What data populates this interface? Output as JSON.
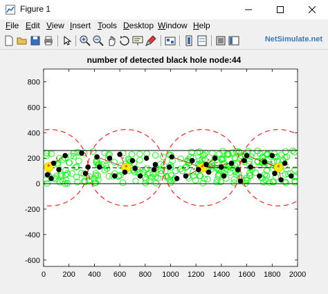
{
  "window": {
    "title": "Figure 1",
    "minimize_icon": "minimize-icon",
    "maximize_icon": "maximize-icon",
    "close_icon": "close-icon"
  },
  "menu": [
    {
      "label": "File",
      "key": "F"
    },
    {
      "label": "Edit",
      "key": "E"
    },
    {
      "label": "View",
      "key": "V"
    },
    {
      "label": "Insert",
      "key": "I"
    },
    {
      "label": "Tools",
      "key": "T"
    },
    {
      "label": "Desktop",
      "key": "D"
    },
    {
      "label": "Window",
      "key": "W"
    },
    {
      "label": "Help",
      "key": "H"
    }
  ],
  "toolbar": {
    "icons": [
      "new-figure-icon",
      "open-file-icon",
      "save-icon",
      "print-icon",
      "edit-plot-arrow-icon",
      "zoom-in-icon",
      "zoom-out-icon",
      "pan-icon",
      "rotate-3d-icon",
      "data-cursor-icon",
      "brush-icon",
      "link-plot-icon",
      "insert-colorbar-icon",
      "insert-legend-icon",
      "hide-plot-tools-icon",
      "show-plot-tools-icon"
    ]
  },
  "watermark": "NetSimulate.net",
  "chart_data": {
    "type": "scatter",
    "title": "number of detected black hole node:44",
    "xlabel": "",
    "ylabel": "",
    "xlim": [
      0,
      2000
    ],
    "ylim": [
      -650,
      900
    ],
    "xticks": [
      "0",
      "200",
      "400",
      "600",
      "800",
      "1000",
      "1200",
      "1400",
      "1600",
      "1800",
      "2000"
    ],
    "yticks": [
      "800",
      "600",
      "400",
      "200",
      "0",
      "-200",
      "-400",
      "-600"
    ],
    "xtick_values": [
      0,
      200,
      400,
      600,
      800,
      1000,
      1200,
      1400,
      1600,
      1800,
      2000
    ],
    "ytick_values": [
      800,
      600,
      400,
      200,
      0,
      -200,
      -400,
      -600
    ],
    "grid": false,
    "colors": {
      "normal_node": "#00ff00",
      "black_hole_node": "#000000",
      "cluster_head": "#ffee00",
      "range_circle": "#ff2020",
      "link": "#cc0000",
      "boundary": "#000000"
    },
    "range_circles": [
      {
        "cx": 50,
        "cy": 125,
        "r": 300
      },
      {
        "cx": 650,
        "cy": 125,
        "r": 300
      },
      {
        "cx": 1250,
        "cy": 125,
        "r": 300
      },
      {
        "cx": 1850,
        "cy": 125,
        "r": 300
      }
    ],
    "boundary_lines": [
      {
        "y": 260,
        "style": "solid"
      },
      {
        "y": 125,
        "style": "dashed"
      },
      {
        "y": 0,
        "style": "solid"
      }
    ],
    "cluster_heads": [
      {
        "x": 40,
        "y": 130
      },
      {
        "x": 650,
        "y": 125
      },
      {
        "x": 1250,
        "y": 125
      },
      {
        "x": 1850,
        "y": 125
      }
    ],
    "black_hole_nodes": [
      {
        "x": 30,
        "y": 70
      },
      {
        "x": 80,
        "y": 160
      },
      {
        "x": 60,
        "y": 40
      },
      {
        "x": 170,
        "y": 220
      },
      {
        "x": 300,
        "y": 240
      },
      {
        "x": 330,
        "y": 80
      },
      {
        "x": 420,
        "y": 210
      },
      {
        "x": 350,
        "y": 130
      },
      {
        "x": 440,
        "y": 130
      },
      {
        "x": 520,
        "y": 200
      },
      {
        "x": 560,
        "y": 60
      },
      {
        "x": 600,
        "y": 230
      },
      {
        "x": 700,
        "y": 180
      },
      {
        "x": 720,
        "y": 120
      },
      {
        "x": 640,
        "y": 90
      },
      {
        "x": 810,
        "y": 200
      },
      {
        "x": 870,
        "y": 110
      },
      {
        "x": 880,
        "y": 150
      },
      {
        "x": 990,
        "y": 130
      },
      {
        "x": 1050,
        "y": 40
      },
      {
        "x": 1010,
        "y": 210
      },
      {
        "x": 1170,
        "y": 180
      },
      {
        "x": 1120,
        "y": 60
      },
      {
        "x": 1220,
        "y": 110
      },
      {
        "x": 1280,
        "y": 150
      },
      {
        "x": 1300,
        "y": 90
      },
      {
        "x": 1350,
        "y": 200
      },
      {
        "x": 1400,
        "y": 130
      },
      {
        "x": 1420,
        "y": 60
      },
      {
        "x": 1480,
        "y": 160
      },
      {
        "x": 1530,
        "y": 110
      },
      {
        "x": 1600,
        "y": 220
      },
      {
        "x": 1630,
        "y": 130
      },
      {
        "x": 1700,
        "y": 60
      },
      {
        "x": 1740,
        "y": 170
      },
      {
        "x": 1800,
        "y": 220
      },
      {
        "x": 1820,
        "y": 80
      },
      {
        "x": 1870,
        "y": 30
      },
      {
        "x": 1900,
        "y": 160
      },
      {
        "x": 1950,
        "y": 60
      },
      {
        "x": 1550,
        "y": 20
      },
      {
        "x": 1580,
        "y": 180
      },
      {
        "x": 760,
        "y": 60
      },
      {
        "x": 120,
        "y": 110
      }
    ],
    "normal_nodes_count": 300,
    "seed": 7
  }
}
